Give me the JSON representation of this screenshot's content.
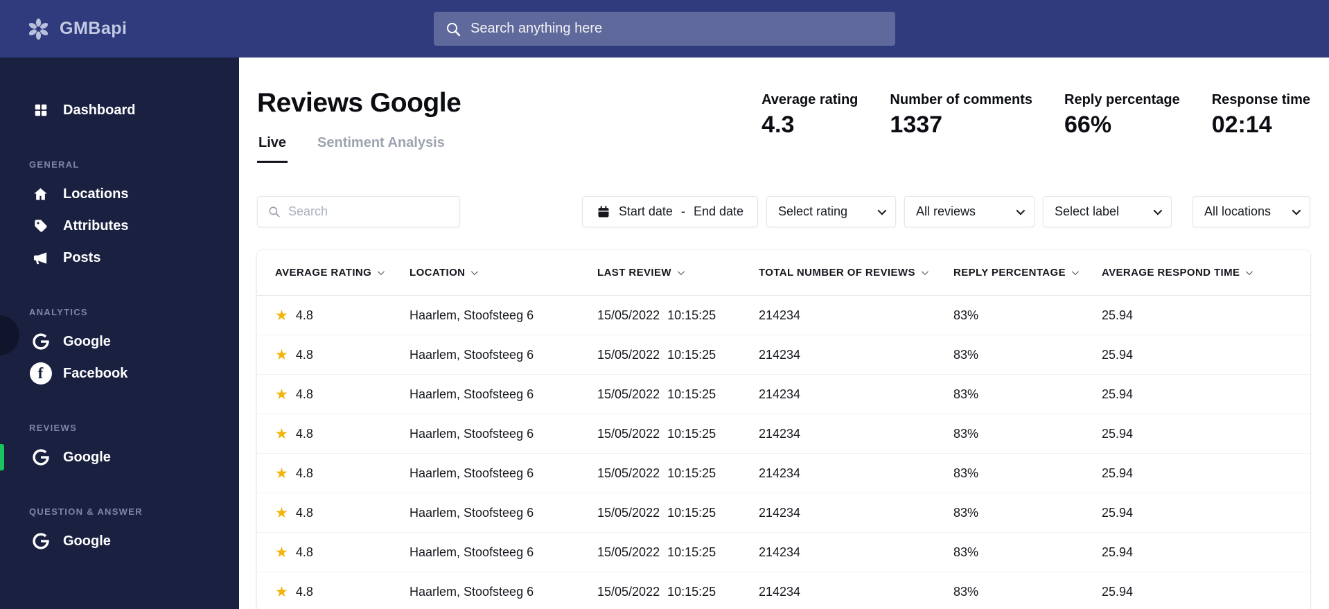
{
  "topbar": {
    "logo_text": "GMBapi",
    "search_placeholder": "Search anything here"
  },
  "sidebar": {
    "dashboard_label": "Dashboard",
    "sections": [
      {
        "title": "General",
        "items": [
          {
            "label": "Locations"
          },
          {
            "label": "Attributes"
          },
          {
            "label": "Posts"
          }
        ]
      },
      {
        "title": "Analytics",
        "items": [
          {
            "label": "Google"
          },
          {
            "label": "Facebook"
          }
        ]
      },
      {
        "title": "Reviews",
        "items": [
          {
            "label": "Google"
          }
        ]
      },
      {
        "title": "Question & Answer",
        "items": [
          {
            "label": "Google"
          }
        ]
      }
    ]
  },
  "main": {
    "title": "Reviews Google",
    "tabs": [
      {
        "label": "Live"
      },
      {
        "label": "Sentiment Analysis"
      }
    ],
    "stats": [
      {
        "label": "Average rating",
        "value": "4.3"
      },
      {
        "label": "Number of comments",
        "value": "1337"
      },
      {
        "label": "Reply percentage",
        "value": "66%"
      },
      {
        "label": "Response time",
        "value": "02:14"
      }
    ],
    "filters": {
      "search_placeholder": "Search",
      "date_start": "Start date",
      "date_separator": "-",
      "date_end": "End date",
      "rating_dropdown": "Select rating",
      "reviews_dropdown": "All reviews",
      "label_dropdown": "Select label",
      "locations_dropdown": "All locations"
    },
    "table": {
      "headers": [
        {
          "label": "Average rating"
        },
        {
          "label": "Location"
        },
        {
          "label": "Last review"
        },
        {
          "label": "Total number of reviews"
        },
        {
          "label": "Reply percentage"
        },
        {
          "label": "Average respond time"
        }
      ],
      "rows": [
        {
          "rating": "4.8",
          "location": "Haarlem, Stoofsteeg 6",
          "date": "15/05/2022",
          "time": "10:15:25",
          "total_reviews": "214234",
          "reply_pct": "83%",
          "respond_time": "25.94"
        },
        {
          "rating": "4.8",
          "location": "Haarlem, Stoofsteeg 6",
          "date": "15/05/2022",
          "time": "10:15:25",
          "total_reviews": "214234",
          "reply_pct": "83%",
          "respond_time": "25.94"
        },
        {
          "rating": "4.8",
          "location": "Haarlem, Stoofsteeg 6",
          "date": "15/05/2022",
          "time": "10:15:25",
          "total_reviews": "214234",
          "reply_pct": "83%",
          "respond_time": "25.94"
        },
        {
          "rating": "4.8",
          "location": "Haarlem, Stoofsteeg 6",
          "date": "15/05/2022",
          "time": "10:15:25",
          "total_reviews": "214234",
          "reply_pct": "83%",
          "respond_time": "25.94"
        },
        {
          "rating": "4.8",
          "location": "Haarlem, Stoofsteeg 6",
          "date": "15/05/2022",
          "time": "10:15:25",
          "total_reviews": "214234",
          "reply_pct": "83%",
          "respond_time": "25.94"
        },
        {
          "rating": "4.8",
          "location": "Haarlem, Stoofsteeg 6",
          "date": "15/05/2022",
          "time": "10:15:25",
          "total_reviews": "214234",
          "reply_pct": "83%",
          "respond_time": "25.94"
        },
        {
          "rating": "4.8",
          "location": "Haarlem, Stoofsteeg 6",
          "date": "15/05/2022",
          "time": "10:15:25",
          "total_reviews": "214234",
          "reply_pct": "83%",
          "respond_time": "25.94"
        },
        {
          "rating": "4.8",
          "location": "Haarlem, Stoofsteeg 6",
          "date": "15/05/2022",
          "time": "10:15:25",
          "total_reviews": "214234",
          "reply_pct": "83%",
          "respond_time": "25.94"
        }
      ]
    }
  },
  "colors": {
    "topbar": "#2f3b7c",
    "sidebar": "#1a2040",
    "accent_green": "#19c55d",
    "star": "#f2b30b"
  }
}
